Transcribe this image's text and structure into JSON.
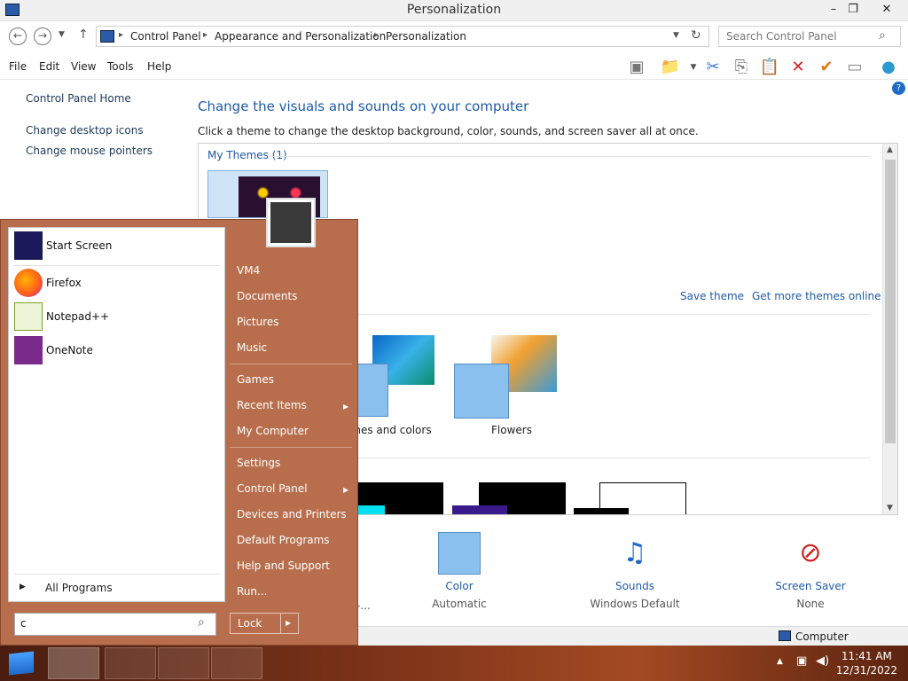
{
  "window": {
    "title": "Personalization",
    "minimize": "–",
    "maximize": "❐",
    "close": "✕"
  },
  "address": {
    "crumbs": [
      "Control Panel",
      "Appearance and Personalization",
      "Personalization"
    ],
    "search_placeholder": "Search Control Panel"
  },
  "menubar": [
    "File",
    "Edit",
    "View",
    "Tools",
    "Help"
  ],
  "leftnav": {
    "home": "Control Panel Home",
    "desktop_icons": "Change desktop icons",
    "mouse_pointers": "Change mouse pointers"
  },
  "main": {
    "heading": "Change the visuals and sounds on your computer",
    "subtitle": "Click a theme to change the desktop background, color, sounds, and screen saver all at once.",
    "my_themes": "My Themes (1)",
    "save_theme": "Save theme",
    "get_more": "Get more themes online",
    "theme_lines_colors": "Lines and colors",
    "theme_lines_visible": "ines and colors",
    "theme_flowers": "Flowers"
  },
  "bottom": {
    "color_label": "Color",
    "color_value": "Automatic",
    "sounds_label": "Sounds",
    "sounds_value": "Windows Default",
    "saver_label": "Screen Saver",
    "saver_value": "None",
    "partial_value": "-..."
  },
  "status": {
    "computer": "Computer"
  },
  "startmenu": {
    "items": [
      {
        "label": "Start Screen"
      },
      {
        "label": "Firefox"
      },
      {
        "label": "Notepad++"
      },
      {
        "label": "OneNote"
      }
    ],
    "all_programs": "All Programs",
    "search_value": "c",
    "right": [
      "VM4",
      "Documents",
      "Pictures",
      "Music",
      "Games",
      "Recent Items",
      "My Computer",
      "Settings",
      "Control Panel",
      "Devices and Printers",
      "Default Programs",
      "Help and Support",
      "Run..."
    ],
    "lock": "Lock"
  },
  "taskbar": {
    "time": "11:41 AM",
    "date": "12/31/2022"
  }
}
